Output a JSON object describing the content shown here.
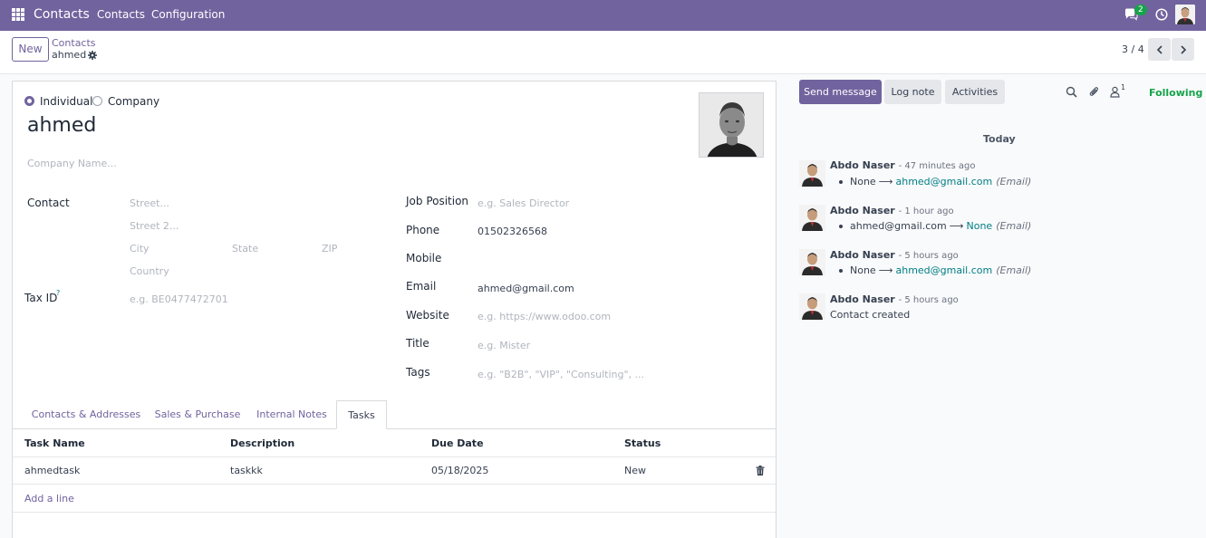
{
  "navbar": {
    "app_name": "Contacts",
    "menu": [
      "Contacts",
      "Configuration"
    ],
    "chat_badge": "2",
    "accent": "#71639e"
  },
  "control": {
    "new_label": "New",
    "breadcrumb_parent": "Contacts",
    "breadcrumb_current": "ahmed",
    "pager": "3 / 4"
  },
  "form": {
    "type_options": [
      "Individual",
      "Company"
    ],
    "type_selected": "Individual",
    "name": "ahmed",
    "company_placeholder": "Company Name...",
    "contact_label": "Contact",
    "street_placeholder": "Street...",
    "street2_placeholder": "Street 2...",
    "city_placeholder": "City",
    "state_placeholder": "State",
    "zip_placeholder": "ZIP",
    "country_placeholder": "Country",
    "taxid_label": "Tax ID",
    "taxid_help": "?",
    "taxid_placeholder": "e.g. BE0477472701",
    "job_label": "Job Position",
    "job_placeholder": "e.g. Sales Director",
    "phone_label": "Phone",
    "phone_value": "01502326568",
    "mobile_label": "Mobile",
    "email_label": "Email",
    "email_value": "ahmed@gmail.com",
    "website_label": "Website",
    "website_placeholder": "e.g. https://www.odoo.com",
    "title_label": "Title",
    "title_placeholder": "e.g. Mister",
    "tags_label": "Tags",
    "tags_placeholder": "e.g. \"B2B\", \"VIP\", \"Consulting\", ..."
  },
  "tabs": [
    "Contacts & Addresses",
    "Sales & Purchase",
    "Internal Notes",
    "Tasks"
  ],
  "active_tab": "Tasks",
  "tasks": {
    "columns": [
      "Task Name",
      "Description",
      "Due Date",
      "Status"
    ],
    "rows": [
      {
        "name": "ahmedtask",
        "description": "taskkk",
        "due": "05/18/2025",
        "status": "New"
      }
    ],
    "add_line": "Add a line"
  },
  "chatter": {
    "send_message": "Send message",
    "log_note": "Log note",
    "activities": "Activities",
    "followers_count": "1",
    "following": "Following",
    "day_separator": "Today",
    "messages": [
      {
        "author": "Abdo Naser",
        "time": "- 47 minutes ago",
        "from": "None",
        "to": "ahmed@gmail.com",
        "field": "(Email)"
      },
      {
        "author": "Abdo Naser",
        "time": "- 1 hour ago",
        "from": "ahmed@gmail.com",
        "to": "None",
        "field": "(Email)"
      },
      {
        "author": "Abdo Naser",
        "time": "- 5 hours ago",
        "from": "None",
        "to": "ahmed@gmail.com",
        "field": "(Email)"
      },
      {
        "author": "Abdo Naser",
        "time": "- 5 hours ago",
        "text": "Contact created"
      }
    ]
  }
}
